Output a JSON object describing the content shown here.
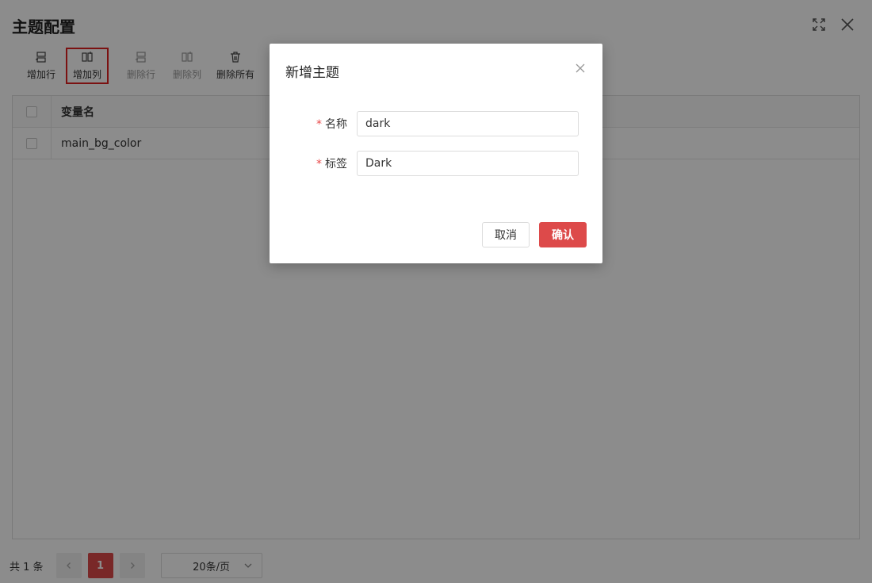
{
  "window": {
    "title": "主题配置"
  },
  "toolbar": {
    "add_row": "增加行",
    "add_col": "增加列",
    "del_row": "删除行",
    "del_col": "删除列",
    "del_all": "删除所有"
  },
  "grid": {
    "header": "变量名",
    "rows": [
      {
        "name": "main_bg_color"
      }
    ]
  },
  "pager": {
    "total": "共 1 条",
    "current_page": "1",
    "page_size": "20条/页"
  },
  "dialog": {
    "title": "新增主题",
    "name_label": "名称",
    "name_value": "dark",
    "tag_label": "标签",
    "tag_value": "Dark",
    "required_mark": "*",
    "cancel": "取消",
    "confirm": "确认"
  },
  "colors": {
    "accent": "#dd4a4a",
    "highlight": "#e02020"
  }
}
